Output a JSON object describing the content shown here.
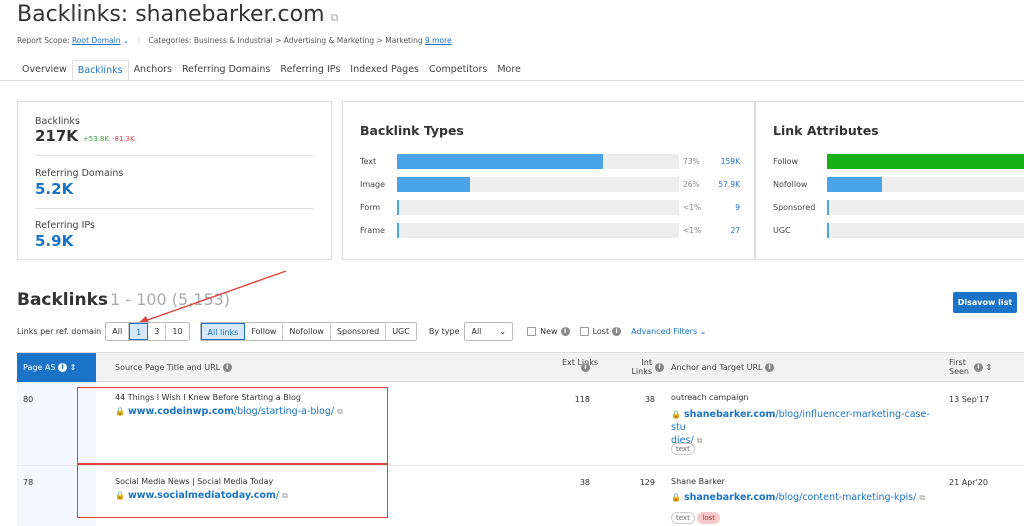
{
  "header": {
    "title_prefix": "Backlinks: ",
    "title_domain": "shanebarker.com",
    "scope_label": "Report Scope:",
    "scope_value": "Root Domain",
    "categories_label": "Categories:",
    "categories_value": "Business & Industrial > Advertising & Marketing > Marketing",
    "more_link": "9 more"
  },
  "tabs": [
    "Overview",
    "Backlinks",
    "Anchors",
    "Referring Domains",
    "Referring IPs",
    "Indexed Pages",
    "Competitors",
    "More"
  ],
  "active_tab": "Backlinks",
  "kpis": {
    "backlinks_label": "Backlinks",
    "backlinks_value": "217K",
    "backlinks_new": "+53.8K",
    "backlinks_lost": "-81.3K",
    "ref_domains_label": "Referring Domains",
    "ref_domains_value": "5.2K",
    "ref_ips_label": "Referring IPs",
    "ref_ips_value": "5.9K"
  },
  "backlink_types": {
    "title": "Backlink Types",
    "rows": [
      {
        "label": "Text",
        "percent_text": "73%",
        "count": "159K",
        "fill": 0.73
      },
      {
        "label": "Image",
        "percent_text": "26%",
        "count": "57.9K",
        "fill": 0.26
      },
      {
        "label": "Form",
        "percent_text": "<1%",
        "count": "9",
        "fill": 0.005
      },
      {
        "label": "Frame",
        "percent_text": "<1%",
        "count": "27",
        "fill": 0.005
      }
    ]
  },
  "link_attributes": {
    "title": "Link Attributes",
    "rows": [
      {
        "label": "Follow",
        "fill": 1.0
      },
      {
        "label": "Nofollow",
        "fill": 0.28
      },
      {
        "label": "Sponsored",
        "fill": 0.005
      },
      {
        "label": "UGC",
        "fill": 0.005
      }
    ]
  },
  "backlinks_section": {
    "title": "Backlinks",
    "range": "1 - 100 (5,153)",
    "disavow_label": "Disavow list"
  },
  "filters": {
    "per_domain_label": "Links per ref. domain",
    "per_domain_options": [
      "All",
      "1",
      "3",
      "10"
    ],
    "link_types": [
      "All links",
      "Follow",
      "Nofollow",
      "Sponsored",
      "UGC"
    ],
    "by_type_label": "By type",
    "by_type_value": "All",
    "new_label": "New",
    "lost_label": "Lost",
    "advanced_label": "Advanced Filters"
  },
  "table": {
    "headers": {
      "page_as": "Page AS",
      "source": "Source Page Title and URL",
      "ext_links": "Ext Links",
      "int_links": "Int Links",
      "anchor": "Anchor and Target URL",
      "first_seen": "First Seen"
    },
    "rows": [
      {
        "page_as": "80",
        "source_title": "44 Things I Wish I Knew Before Starting a Blog",
        "source_domain": "www.codeinwp.com",
        "source_path": "/blog/starting-a-blog/",
        "ext": "118",
        "int": "38",
        "anchor": "outreach campaign",
        "target_domain": "shanebarker.com",
        "target_path_1": "/blog/influencer-marketing-case-stu",
        "target_path_2": "dies/",
        "tags": [
          "text"
        ],
        "first_seen": "13 Sep'17"
      },
      {
        "page_as": "78",
        "source_title": "Social Media News | Social Media Today",
        "source_domain": "www.socialmediatoday.com",
        "source_path": "/",
        "ext": "38",
        "int": "129",
        "anchor": "Shane Barker",
        "target_domain": "shanebarker.com",
        "target_path_1": "/blog/content-marketing-kpis/",
        "target_path_2": "",
        "tags": [
          "text",
          "lost"
        ],
        "first_seen": "21 Apr'20"
      }
    ]
  },
  "colors": {
    "accent": "#1a73c7",
    "bar_blue": "#4ba3e8",
    "follow_green": "#17b117",
    "annotation_red": "#e0413f"
  }
}
